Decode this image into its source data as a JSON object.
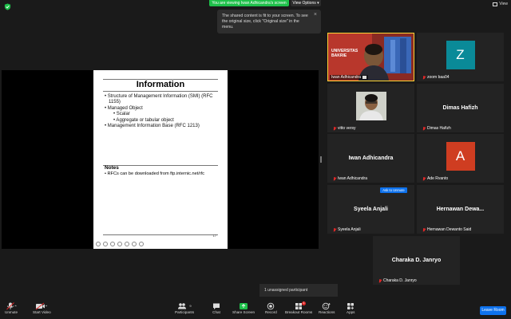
{
  "topbar": {
    "share_banner": "You are viewing Iwan Adhicandra's screen",
    "view_options": "View Options ▾",
    "view": "View"
  },
  "tooltip": {
    "text": "The shared content is fit to your screen. To see the original size, click \"Original size\" in the menu.",
    "close": "×"
  },
  "slide": {
    "title": "Information",
    "bullets": [
      {
        "text": "• Structure of Management Information (SMI) (RFC 1155)",
        "level": 1
      },
      {
        "text": "• Managed Object",
        "level": 1
      },
      {
        "text": "• Scalar",
        "level": 2
      },
      {
        "text": "• Aggregate or tabular object",
        "level": 2
      },
      {
        "text": "• Management Information Base (RFC 1213)",
        "level": 1
      }
    ],
    "notes_title": "Notes",
    "notes_text": "• RFCs can be downloaded from ftp.internic.net/rfc",
    "page": "17"
  },
  "participants": [
    {
      "id": "p1",
      "name": "Iwan Adhicandra",
      "muted": false,
      "kind": "video"
    },
    {
      "id": "p2",
      "name": "zoom baa04",
      "muted": true,
      "kind": "avatar",
      "initial": "Z",
      "color": "#0a8a98"
    },
    {
      "id": "p3",
      "name": "vitto versy",
      "muted": true,
      "kind": "video"
    },
    {
      "id": "p4",
      "name": "Dimas Hafizh",
      "muted": true,
      "kind": "name",
      "display": "Dimas Hafizh"
    },
    {
      "id": "p5",
      "name": "Iwan Adhicandra",
      "muted": true,
      "kind": "name",
      "display": "Iwan Adhicandra"
    },
    {
      "id": "p6",
      "name": "Ade Rvanto",
      "muted": true,
      "kind": "avatar",
      "initial": "A",
      "color": "#cf3d21"
    },
    {
      "id": "p7",
      "name": "Syeela Anjali",
      "muted": true,
      "kind": "name",
      "display": "Syeela Anjali"
    },
    {
      "id": "p8",
      "name": "Hernawan Dewanto Said",
      "muted": true,
      "kind": "name",
      "display": "Hernawan Dewa..."
    },
    {
      "id": "p9",
      "name": "Charaka D. Janryo",
      "muted": true,
      "kind": "name",
      "display": "Charaka D. Janryo"
    }
  ],
  "ask_unmute": "Ask to Unmute",
  "unassigned": "1 unassigned participant",
  "video_tile": {
    "logo_line1": "UNIVERSITAS",
    "logo_line2": "BAKRIE"
  },
  "toolbar": {
    "unmute": "Unmute",
    "start_video": "Start Video",
    "participants": "Participants",
    "participant_count": "9",
    "chat": "Chat",
    "share_screen": "Share Screen",
    "record": "Record",
    "breakout": "Breakout Rooms",
    "breakout_badge": "1",
    "reactions": "Reactions",
    "apps": "Apps",
    "leave": "Leave Room"
  },
  "colors": {
    "accent": "#0e72ed",
    "share_green": "#1ec04a",
    "muted_red": "#e02828",
    "active_speaker": "#fcd536"
  }
}
